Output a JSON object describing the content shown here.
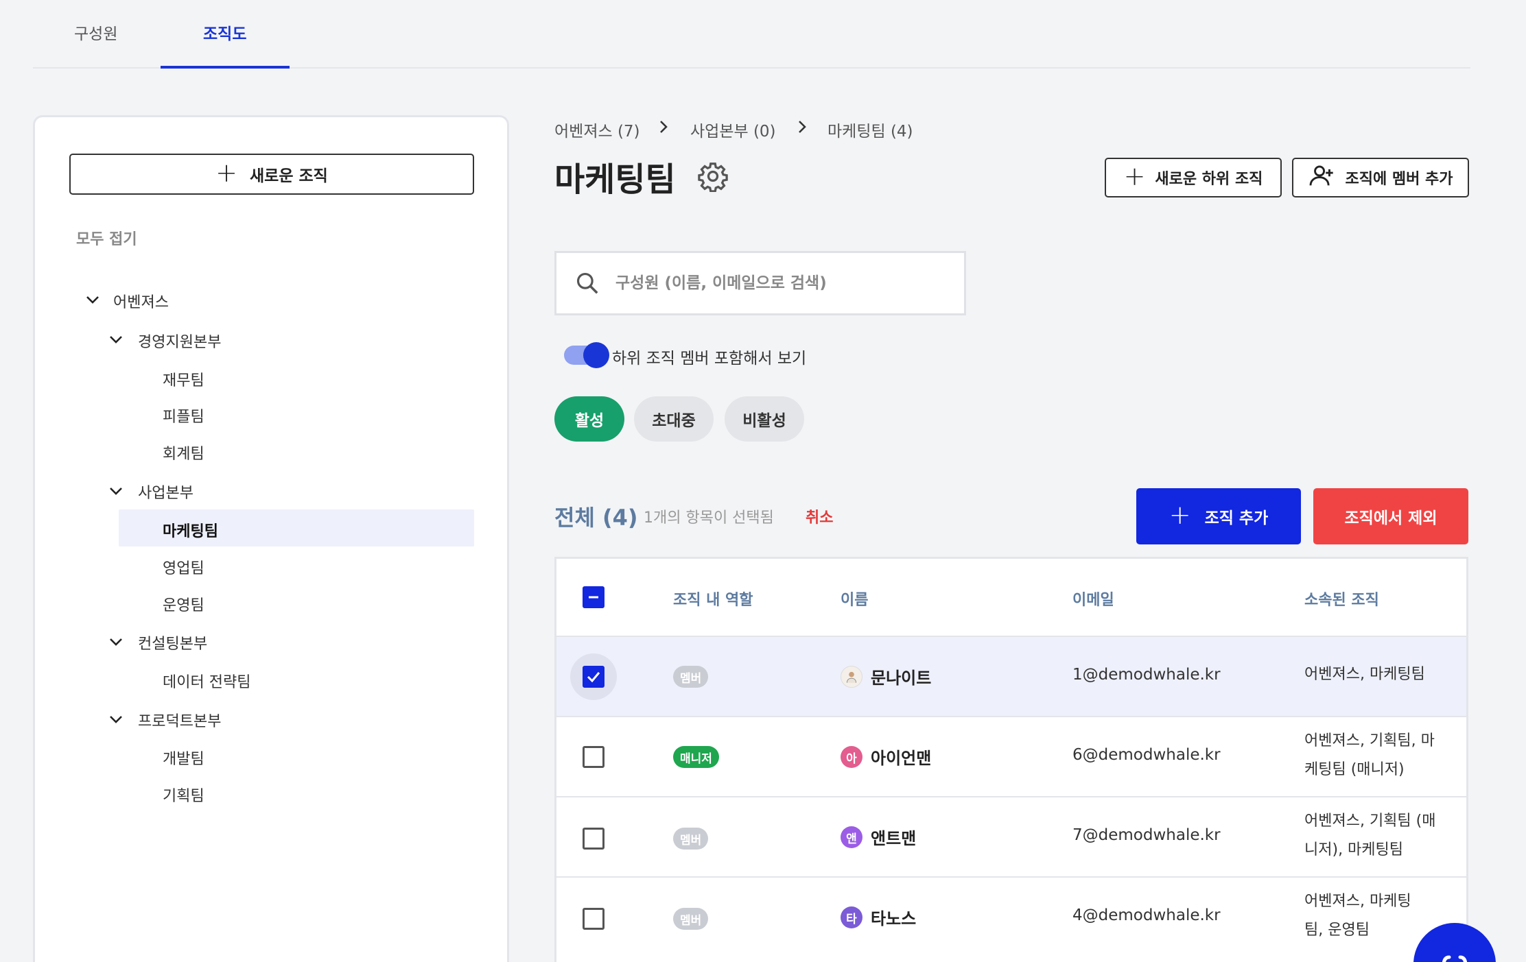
{
  "tabs": [
    {
      "label": "구성원"
    },
    {
      "label": "조직도"
    }
  ],
  "sidebar": {
    "new_org_label": "새로운 조직",
    "collapse_all_label": "모두 접기",
    "tree": [
      {
        "label": "어벤져스"
      },
      {
        "label": "경영지원본부"
      },
      {
        "label": "재무팀"
      },
      {
        "label": "피플팀"
      },
      {
        "label": "회계팀"
      },
      {
        "label": "사업본부"
      },
      {
        "label": "마케팅팀"
      },
      {
        "label": "영업팀"
      },
      {
        "label": "운영팀"
      },
      {
        "label": "컨설팅본부"
      },
      {
        "label": "데이터 전략팀"
      },
      {
        "label": "프로덕트본부"
      },
      {
        "label": "개발팀"
      },
      {
        "label": "기획팀"
      }
    ],
    "selected": "마케팅팀"
  },
  "breadcrumb": [
    {
      "label": "어벤져스 (7)"
    },
    {
      "label": "사업본부 (0)"
    },
    {
      "label": "마케팅팀 (4)"
    }
  ],
  "main": {
    "title": "마케팅팀",
    "new_sub_org_label": "새로운 하위 조직",
    "add_member_label": "조직에 멤버 추가",
    "search_placeholder": "구성원 (이름, 이메일으로 검색)",
    "toggle_label": "하위 조직 멤버 포함해서 보기",
    "toggle_on": true,
    "filters": [
      {
        "label": "활성",
        "active": true
      },
      {
        "label": "초대중",
        "active": false
      },
      {
        "label": "비활성",
        "active": false
      }
    ],
    "total_label": "전체 (4)",
    "selected_info": "1개의 항목이 선택됨",
    "cancel_label": "취소",
    "add_org_label": "조직 추가",
    "remove_label": "조직에서 제외"
  },
  "table": {
    "columns": [
      "조직 내 역할",
      "이름",
      "이메일",
      "소속된 조직"
    ],
    "rows": [
      {
        "checked": true,
        "role": "멤버",
        "avatar": "",
        "name": "문나이트",
        "email": "1@demodwhale.kr",
        "orgs": "어벤져스, 마케팅팀"
      },
      {
        "checked": false,
        "role": "매니저",
        "avatar": "아",
        "name": "아이언맨",
        "email": "6@demodwhale.kr",
        "orgs": "어벤져스, 기획팀, 마케팅팀 (매니저)"
      },
      {
        "checked": false,
        "role": "멤버",
        "avatar": "앤",
        "name": "앤트맨",
        "email": "7@demodwhale.kr",
        "orgs": "어벤져스, 기획팀 (매니저), 마케팅팀"
      },
      {
        "checked": false,
        "role": "멤버",
        "avatar": "타",
        "name": "타노스",
        "email": "4@demodwhale.kr",
        "orgs": "어벤져스, 마케팅팀, 운영팀"
      }
    ]
  },
  "colors": {
    "accent": "#1227e0",
    "success": "#17a06b",
    "danger": "#f04444",
    "avatar_pink": "#e35d8f",
    "avatar_purple": "#9b5de5"
  }
}
